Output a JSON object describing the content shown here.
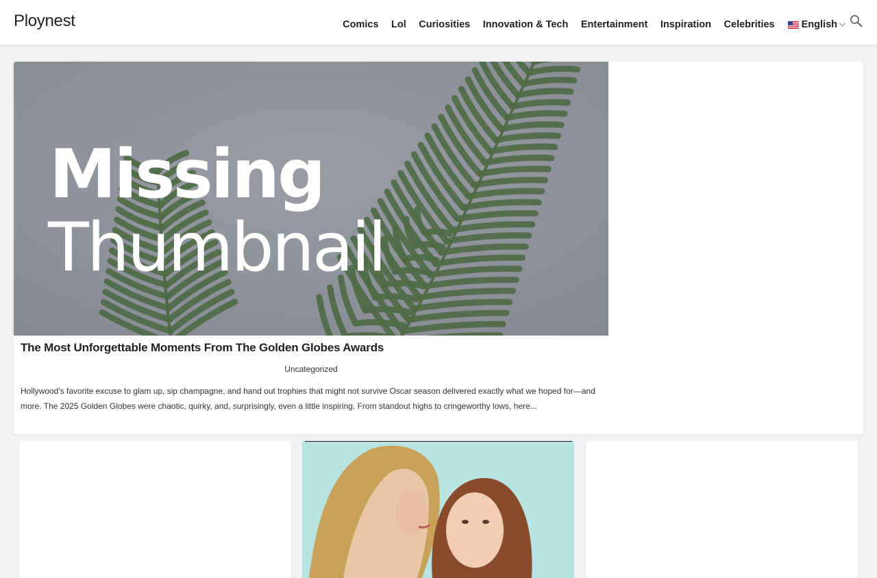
{
  "header": {
    "logo": "Ploynest",
    "nav": [
      "Comics",
      "Lol",
      "Curiosities",
      "Innovation & Tech",
      "Entertainment",
      "Inspiration",
      "Celebrities"
    ],
    "language": "English",
    "language_flag_icon": "us-flag-icon",
    "search_icon": "search-icon"
  },
  "featured": {
    "thumbnail_text": [
      "Missing",
      "Thumbnail"
    ],
    "title": "The Most Unforgettable Moments From The Golden Globes Awards",
    "category": "Uncategorized",
    "excerpt": "Hollywood's favorite excuse to glam up, sip champagne, and hand out trophies that might not survive Oscar season delivered exactly what we hoped for—and more. The 2025 Golden Globes were chaotic, quirky, and, surprisingly, even a little inspiring. From standout highs to cringeworthy lows, here..."
  },
  "colors": {
    "page_bg": "#f1f1f1",
    "card_bg": "#ffffff",
    "thumb_bg": "#8f929b",
    "fern_green": "#4e6b45",
    "photo_bg": "#b7e3e0"
  }
}
